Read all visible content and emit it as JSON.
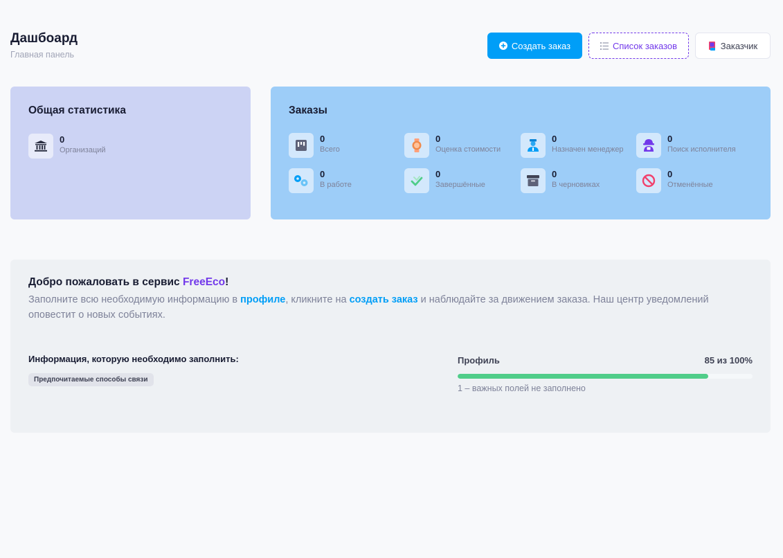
{
  "header": {
    "title": "Дашбоард",
    "subtitle": "Главная панель"
  },
  "actions": {
    "create_order": "Создать заказ",
    "orders_list": "Список заказов",
    "customer": "Заказчик"
  },
  "general_stats": {
    "title": "Общая статистика",
    "items": [
      {
        "value": "0",
        "label": "Организаций",
        "icon": "bank-icon"
      }
    ]
  },
  "orders": {
    "title": "Заказы",
    "items": [
      {
        "value": "0",
        "label": "Всего",
        "icon": "board-icon"
      },
      {
        "value": "0",
        "label": "Оценка стоимости",
        "icon": "watch-icon"
      },
      {
        "value": "0",
        "label": "Назначен менеджер",
        "icon": "manager-icon"
      },
      {
        "value": "0",
        "label": "Поиск исполнителя",
        "icon": "incognito-icon"
      },
      {
        "value": "0",
        "label": "В работе",
        "icon": "gears-icon"
      },
      {
        "value": "0",
        "label": "Завершённые",
        "icon": "check-icon"
      },
      {
        "value": "0",
        "label": "В черновиках",
        "icon": "archive-icon"
      },
      {
        "value": "0",
        "label": "Отменённые",
        "icon": "cancel-icon"
      }
    ]
  },
  "welcome": {
    "title_prefix": "Добро пожаловать в сервис ",
    "brand": "FreeEco",
    "title_suffix": "!",
    "text_1": "Заполните всю необходимую информацию в ",
    "link_profile": "профиле",
    "text_2": ", кликните на ",
    "link_create": "создать заказ",
    "text_3": " и наблюдайте за движением заказа. Наш центр уведомлений оповестит о новых событиях.",
    "info_title": "Информация, которую необходимо заполнить:",
    "missing_fields": [
      "Предпочитаемые способы связи"
    ]
  },
  "profile_progress": {
    "label": "Профиль",
    "value_text": "85 из 100%",
    "percent": 85,
    "note": "1 – важных полей не заполнено"
  },
  "colors": {
    "primary": "#009ef7",
    "brand": "#7239ea",
    "success": "#50cd89",
    "stats_card": "#ccd3f4",
    "orders_card": "#9dcdf8"
  }
}
